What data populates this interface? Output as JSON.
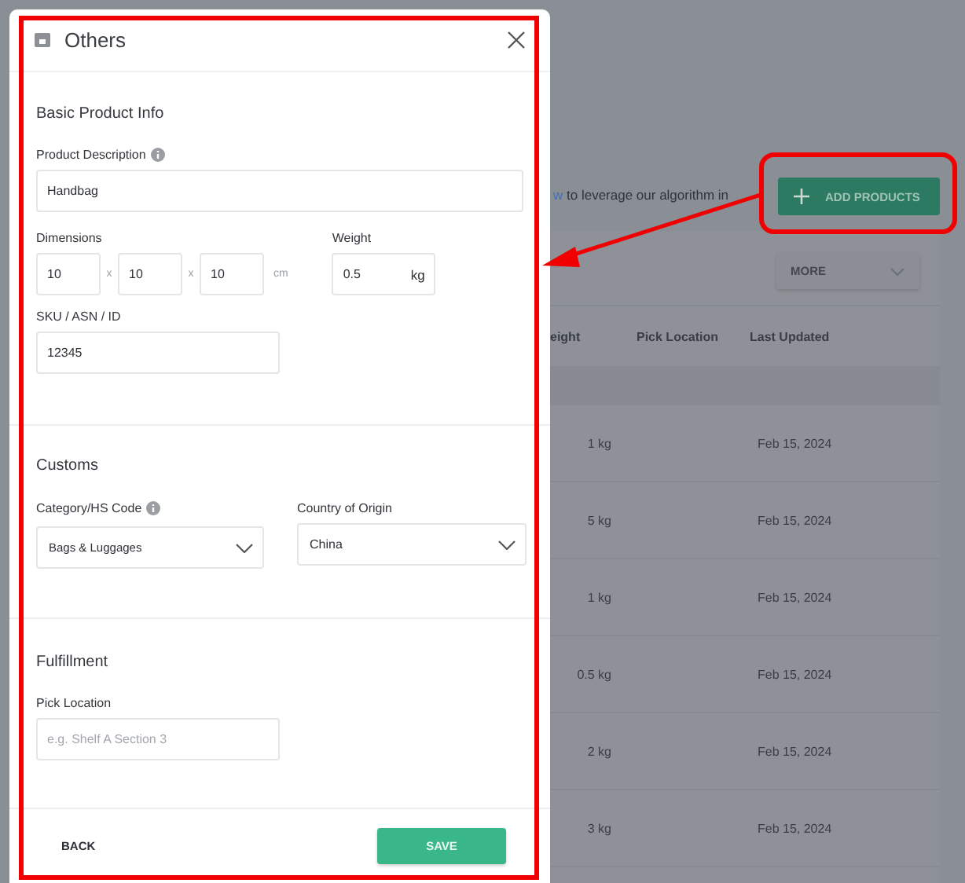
{
  "background": {
    "notice": {
      "link": "w",
      "text": " to leverage our algorithm in"
    },
    "add_button": {
      "label": "ADD PRODUCTS"
    },
    "more": {
      "label": "MORE"
    },
    "columns": [
      "eight",
      "Pick Location",
      "Last Updated"
    ],
    "rows": [
      {
        "weight": "1 kg",
        "last_updated": "Feb 15, 2024"
      },
      {
        "weight": "5 kg",
        "last_updated": "Feb 15, 2024"
      },
      {
        "weight": "1 kg",
        "last_updated": "Feb 15, 2024"
      },
      {
        "weight": "0.5 kg",
        "last_updated": "Feb 15, 2024"
      },
      {
        "weight": "2 kg",
        "last_updated": "Feb 15, 2024"
      },
      {
        "weight": "3 kg",
        "last_updated": "Feb 15, 2024"
      }
    ]
  },
  "dialog": {
    "title": "Others",
    "basic": {
      "title": "Basic Product Info",
      "description": {
        "label": "Product Description",
        "value": "Handbag"
      },
      "dimensions": {
        "label": "Dimensions",
        "values": [
          "10",
          "10",
          "10"
        ],
        "separators": [
          "x",
          "x"
        ],
        "unit": "cm"
      },
      "weight": {
        "label": "Weight",
        "value": "0.5",
        "unit": "kg"
      },
      "sku": {
        "label": "SKU / ASN / ID",
        "value": "12345"
      }
    },
    "customs": {
      "title": "Customs",
      "category": {
        "label": "Category/HS Code",
        "value": "Bags & Luggages"
      },
      "country": {
        "label": "Country of Origin",
        "value": "China"
      }
    },
    "fulfillment": {
      "title": "Fulfillment",
      "pick_location": {
        "label": "Pick Location",
        "placeholder": "e.g. Shelf A Section 3"
      }
    },
    "buttons": {
      "back": "BACK",
      "save": "SAVE"
    }
  }
}
